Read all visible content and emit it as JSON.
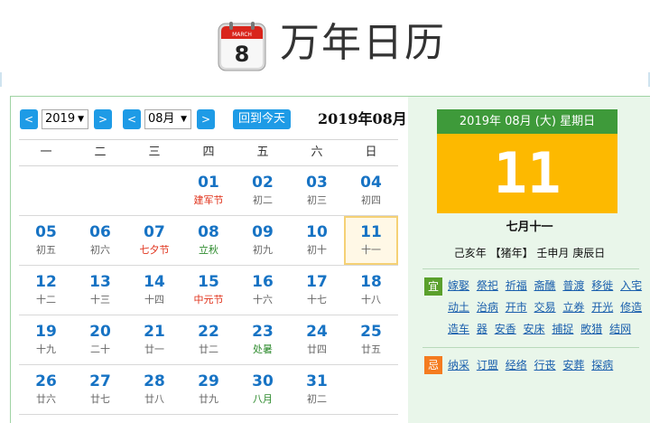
{
  "header": {
    "icon_month": "MARCH",
    "icon_day": "8",
    "title": "万年日历"
  },
  "toolbar": {
    "prev_year_label": "<",
    "year_value": "2019",
    "next_year_label": ">",
    "prev_month_label": "<",
    "month_value": "08月",
    "next_month_label": ">",
    "today_label": "回到今天",
    "current_title": "2019年08月"
  },
  "weekdays": [
    "一",
    "二",
    "三",
    "四",
    "五",
    "六",
    "日"
  ],
  "weeks": [
    [
      {
        "day": "",
        "lunar": ""
      },
      {
        "day": "",
        "lunar": ""
      },
      {
        "day": "",
        "lunar": ""
      },
      {
        "day": "01",
        "lunar": "建军节",
        "tone": "red"
      },
      {
        "day": "02",
        "lunar": "初二"
      },
      {
        "day": "03",
        "lunar": "初三"
      },
      {
        "day": "04",
        "lunar": "初四"
      }
    ],
    [
      {
        "day": "05",
        "lunar": "初五"
      },
      {
        "day": "06",
        "lunar": "初六"
      },
      {
        "day": "07",
        "lunar": "七夕节",
        "tone": "red"
      },
      {
        "day": "08",
        "lunar": "立秋",
        "tone": "green"
      },
      {
        "day": "09",
        "lunar": "初九"
      },
      {
        "day": "10",
        "lunar": "初十"
      },
      {
        "day": "11",
        "lunar": "十一",
        "selected": true
      }
    ],
    [
      {
        "day": "12",
        "lunar": "十二"
      },
      {
        "day": "13",
        "lunar": "十三"
      },
      {
        "day": "14",
        "lunar": "十四"
      },
      {
        "day": "15",
        "lunar": "中元节",
        "tone": "red"
      },
      {
        "day": "16",
        "lunar": "十六"
      },
      {
        "day": "17",
        "lunar": "十七"
      },
      {
        "day": "18",
        "lunar": "十八"
      }
    ],
    [
      {
        "day": "19",
        "lunar": "十九"
      },
      {
        "day": "20",
        "lunar": "二十"
      },
      {
        "day": "21",
        "lunar": "廿一"
      },
      {
        "day": "22",
        "lunar": "廿二"
      },
      {
        "day": "23",
        "lunar": "处暑",
        "tone": "green"
      },
      {
        "day": "24",
        "lunar": "廿四"
      },
      {
        "day": "25",
        "lunar": "廿五"
      }
    ],
    [
      {
        "day": "26",
        "lunar": "廿六"
      },
      {
        "day": "27",
        "lunar": "廿七"
      },
      {
        "day": "28",
        "lunar": "廿八"
      },
      {
        "day": "29",
        "lunar": "廿九"
      },
      {
        "day": "30",
        "lunar": "八月",
        "tone": "green"
      },
      {
        "day": "31",
        "lunar": "初二"
      },
      {
        "day": "",
        "lunar": ""
      }
    ]
  ],
  "detail": {
    "head": "2019年 08月 (大) 星期日",
    "day": "11",
    "lunar_date": "七月十一",
    "ganzhi": "己亥年 【猪年】 壬申月 庚辰日",
    "yi_label": "宜",
    "yi": [
      "嫁娶",
      "祭祀",
      "祈福",
      "斋醮",
      "普渡",
      "移徙",
      "入宅",
      "动土",
      "治病",
      "开市",
      "交易",
      "立券",
      "开光",
      "修造",
      "造车",
      "器",
      "安香",
      "安床",
      "捕捉",
      "畋猎",
      "结网"
    ],
    "ji_label": "忌",
    "ji": [
      "纳采",
      "订盟",
      "经络",
      "行丧",
      "安葬",
      "探病"
    ]
  },
  "colors": {
    "accent_blue": "#1e9be6",
    "date_blue": "#1773c4",
    "festival_red": "#e0321b",
    "solar_term_green": "#2e8b2e",
    "detail_green": "#3e9a3a",
    "detail_gold": "#fdb900",
    "yi_green": "#5aa02c",
    "ji_orange": "#f47b20"
  }
}
